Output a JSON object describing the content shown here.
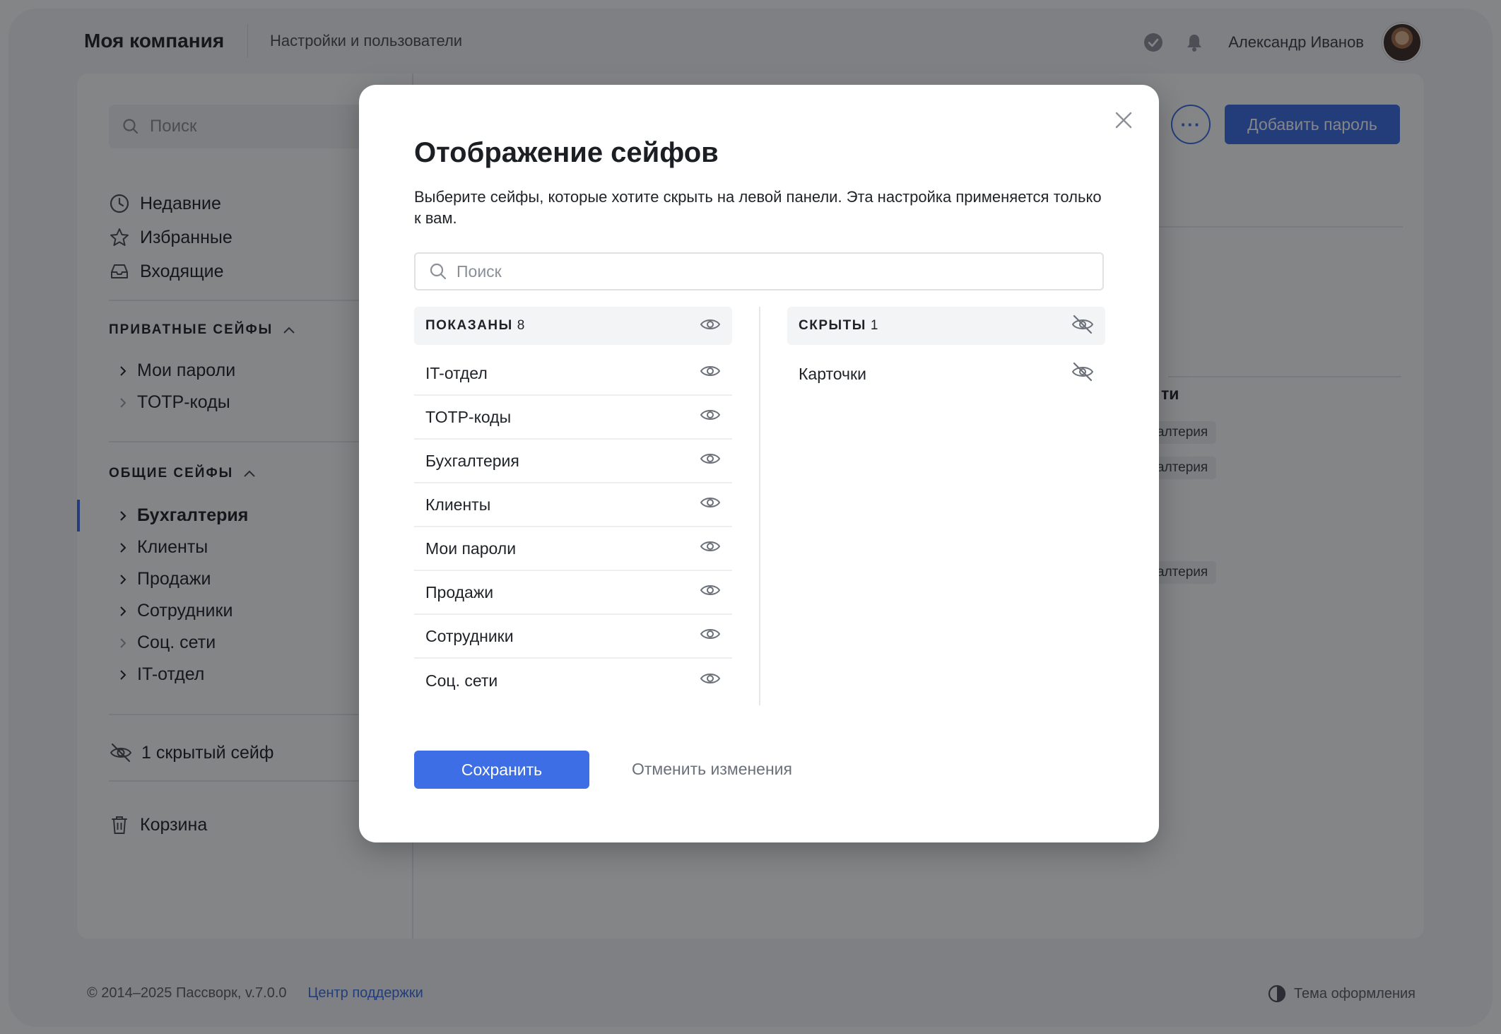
{
  "app": {
    "brand": "Моя компания",
    "section": "Настройки и пользователи",
    "user_name": "Александр Иванов"
  },
  "sidebar": {
    "search_placeholder": "Поиск",
    "nav": [
      {
        "label": "Недавние",
        "icon": "clock-icon"
      },
      {
        "label": "Избранные",
        "icon": "star-icon"
      },
      {
        "label": "Входящие",
        "icon": "inbox-icon"
      }
    ],
    "private_title": "ПРИВАТНЫЕ СЕЙФЫ",
    "private_vaults": [
      "Мои пароли",
      "TOTP-коды"
    ],
    "shared_title": "ОБЩИЕ СЕЙФЫ",
    "shared_vaults": [
      "Бухгалтерия",
      "Клиенты",
      "Продажи",
      "Сотрудники",
      "Соц. сети",
      "IT-отдел"
    ],
    "active_vault": "Бухгалтерия",
    "hidden_label": "1 скрытый сейф",
    "trash_label": "Корзина"
  },
  "main": {
    "more_label": "···",
    "add_password_label": "Добавить пароль",
    "partial_heading": "ти",
    "partial_tags": [
      "хгалтерия",
      "хгалтерия",
      "хгалтерия"
    ]
  },
  "footer": {
    "copyright": "© 2014–2025 Пассворк, v.7.0.0",
    "support_link": "Центр поддержки",
    "theme_label": "Тема оформления"
  },
  "modal": {
    "title": "Отображение сейфов",
    "description": "Выберите сейфы, которые хотите скрыть на левой панели. Эта настройка применяется только к вам.",
    "search_placeholder": "Поиск",
    "shown_title": "ПОКАЗАНЫ",
    "shown_count": "8",
    "shown_items": [
      "IT-отдел",
      "TOTP-коды",
      "Бухгалтерия",
      "Клиенты",
      "Мои пароли",
      "Продажи",
      "Сотрудники",
      "Соц. сети"
    ],
    "hidden_title": "СКРЫТЫ",
    "hidden_count": "1",
    "hidden_items": [
      "Карточки"
    ],
    "save_label": "Сохранить",
    "cancel_label": "Отменить изменения"
  },
  "colors": {
    "accent": "#3d6ee6",
    "overlay": "#0a0c10"
  }
}
